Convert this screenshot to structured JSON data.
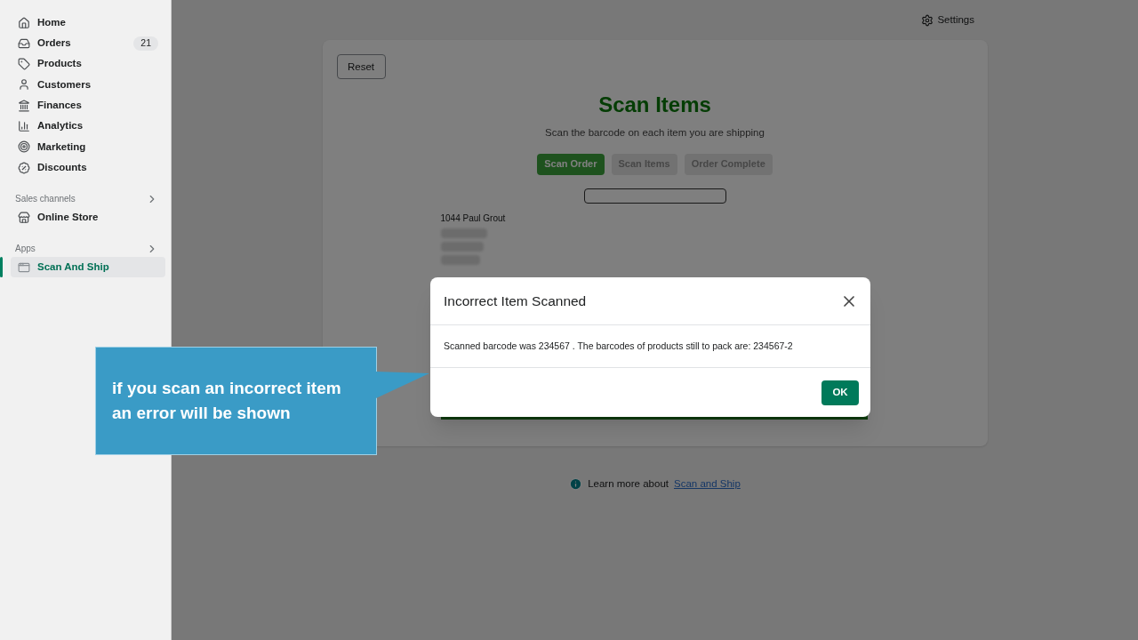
{
  "sidebar": {
    "items": [
      {
        "label": "Home",
        "selected": false
      },
      {
        "label": "Orders",
        "selected": false,
        "badge": "21"
      },
      {
        "label": "Products",
        "selected": false
      },
      {
        "label": "Customers",
        "selected": false
      },
      {
        "label": "Finances",
        "selected": false
      },
      {
        "label": "Analytics",
        "selected": false
      },
      {
        "label": "Marketing",
        "selected": false
      },
      {
        "label": "Discounts",
        "selected": false
      }
    ],
    "sections": [
      {
        "title": "Sales channels",
        "items": [
          {
            "label": "Online Store",
            "selected": false
          }
        ]
      },
      {
        "title": "Apps",
        "items": [
          {
            "label": "Scan And Ship",
            "selected": true
          }
        ]
      }
    ]
  },
  "header": {
    "settings": "Settings"
  },
  "card": {
    "reset": "Reset",
    "title": "Scan Items",
    "subtitle": "Scan the barcode on each item you are shipping",
    "steps": [
      {
        "label": "Scan Order",
        "disabled": false
      },
      {
        "label": "Scan Items",
        "disabled": true
      },
      {
        "label": "Order Complete",
        "disabled": true
      }
    ],
    "address": [
      "1044 Paul Grout"
    ]
  },
  "footer": {
    "text": "Learn more about",
    "link": "Scan and Ship"
  },
  "dialog": {
    "title": "Incorrect Item Scanned",
    "message": "Scanned barcode was 234567 . The barcodes of products still to pack are: 234567-2",
    "ok": "OK"
  },
  "callout": {
    "text": "if you scan an incorrect item an error will be shown"
  }
}
